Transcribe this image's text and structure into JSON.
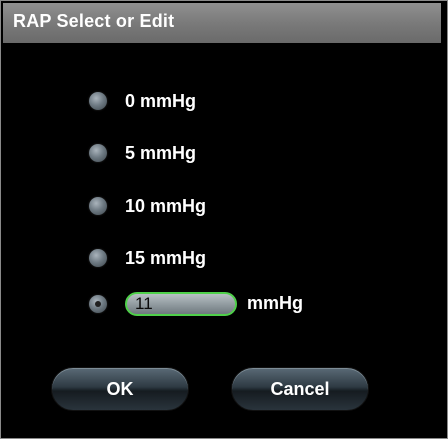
{
  "dialog": {
    "title": "RAP Select or Edit"
  },
  "options": [
    {
      "label": "0 mmHg"
    },
    {
      "label": "5 mmHg"
    },
    {
      "label": "10 mmHg"
    },
    {
      "label": "15 mmHg"
    }
  ],
  "custom": {
    "value": "11",
    "unit": "mmHg"
  },
  "buttons": {
    "ok": "OK",
    "cancel": "Cancel"
  }
}
